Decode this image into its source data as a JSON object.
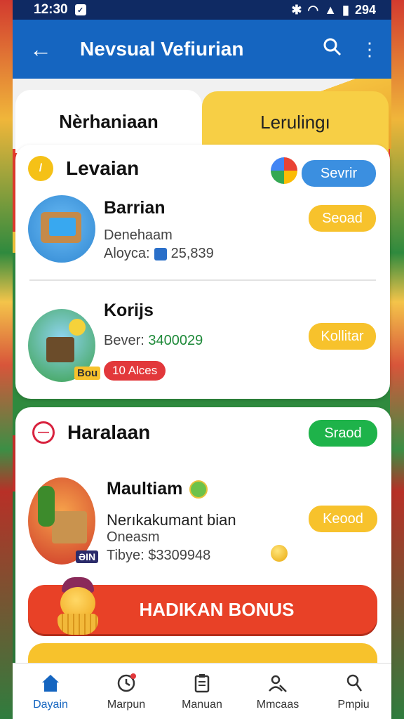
{
  "status": {
    "time": "12:30",
    "battery": "294"
  },
  "appbar": {
    "title": "Nevsual Vefiurian"
  },
  "tabs": [
    {
      "label": "Nèrhaniaan",
      "active": true
    },
    {
      "label": "Lerulingı",
      "active": false
    }
  ],
  "section1": {
    "title": "Levaian",
    "button": "Sevrir",
    "items": [
      {
        "title": "Barrian",
        "line1": "Denehaam",
        "line2": "Aloyca:",
        "value": "25,839",
        "button": "Seoad"
      },
      {
        "title": "Korijs",
        "line1": "Bever:",
        "value": "3400029",
        "badge": "10 Alces",
        "thumb_tag": "Bou",
        "button": "Kollitar"
      }
    ]
  },
  "section2": {
    "title": "Haralaan",
    "button": "Sraod",
    "item": {
      "title": "Maultiam",
      "line1": "Nerıkakumant bian",
      "line2": "Oneasm",
      "line3": "Tibye: $3309948",
      "thumb_tag": "ƏIN",
      "button": "Keood"
    }
  },
  "bonus": {
    "label": "HADIKAN BONUS"
  },
  "nav": [
    {
      "label": "Dayain",
      "icon": "home-icon",
      "active": true
    },
    {
      "label": "Marpun",
      "icon": "clock-icon",
      "active": false
    },
    {
      "label": "Manuan",
      "icon": "clipboard-icon",
      "active": false
    },
    {
      "label": "Mmcaas",
      "icon": "people-icon",
      "active": false
    },
    {
      "label": "Pmpiu",
      "icon": "profile-icon",
      "active": false
    }
  ],
  "colors": {
    "primary": "#1565c0",
    "yellow": "#f7c22c",
    "green": "#1eb34a",
    "red": "#e84127"
  }
}
